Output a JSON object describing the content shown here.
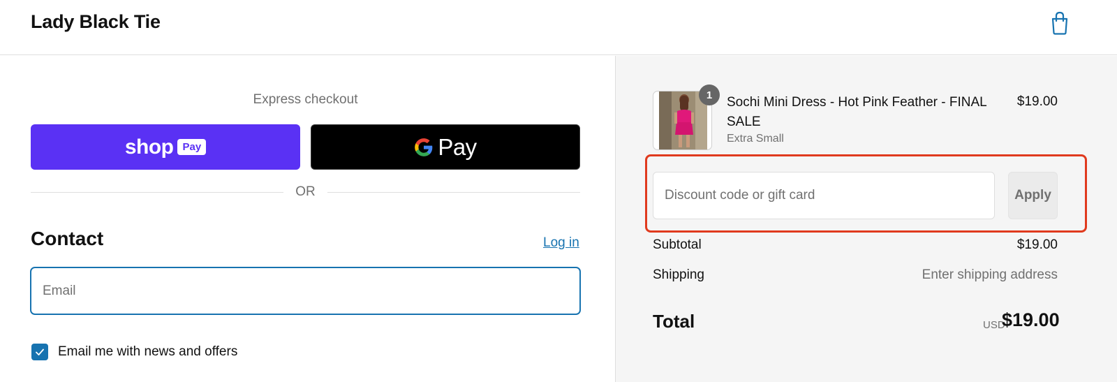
{
  "header": {
    "brand": "Lady Black Tie",
    "cart_icon": "shopping-bag-icon"
  },
  "express": {
    "label": "Express checkout",
    "shop_pay": {
      "word": "shop",
      "badge": "Pay"
    },
    "google_pay": {
      "word": "Pay",
      "icon": "google-g-icon"
    },
    "divider_text": "OR"
  },
  "contact": {
    "title": "Contact",
    "login_link": "Log in",
    "email_placeholder": "Email",
    "email_value": "",
    "newsletter_label": "Email me with news and offers",
    "newsletter_checked": true
  },
  "summary": {
    "item": {
      "name": "Sochi Mini Dress - Hot Pink Feather - FINAL SALE",
      "variant": "Extra Small",
      "price": "$19.00",
      "quantity": "1"
    },
    "discount": {
      "placeholder": "Discount code or gift card",
      "apply_label": "Apply"
    },
    "subtotal_label": "Subtotal",
    "subtotal_value": "$19.00",
    "shipping_label": "Shipping",
    "shipping_value": "Enter shipping address",
    "total_label": "Total",
    "total_currency": "USD",
    "total_value": "$19.00"
  },
  "colors": {
    "shop_pay_purple": "#5a31f4",
    "link_blue": "#1773b0",
    "highlight_red": "#e03a1e",
    "summary_bg": "#f5f5f5",
    "product_pink": "#e0197a"
  }
}
